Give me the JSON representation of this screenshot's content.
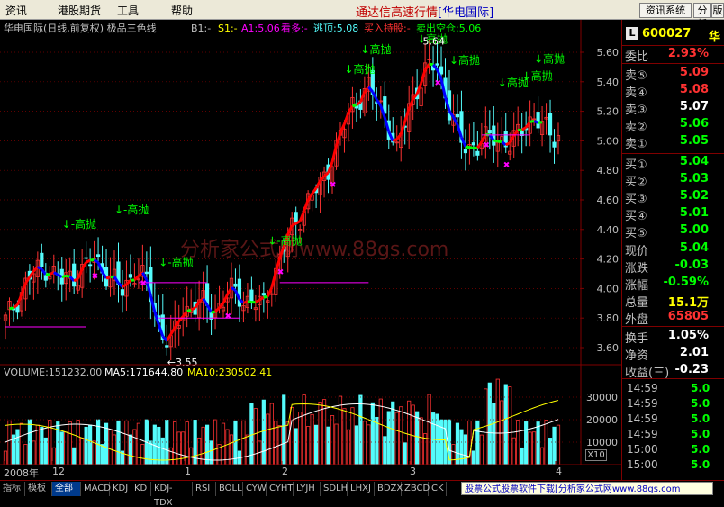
{
  "menu": {
    "items": [
      "资讯",
      "港股期货",
      "工具",
      "帮助"
    ],
    "title": "通达信高速行情",
    "source": "[华电国际]",
    "buttons": [
      "资讯系统",
      "分析",
      "版"
    ]
  },
  "chart_header": {
    "name": "华电国际(日线,前复权) 极品三色线",
    "b1": "B1:-",
    "s1": "S1:-",
    "a1": "A1:5.06",
    "kanduo": "看多:-",
    "taoding": "逃顶:5.08",
    "mairu": "买入持股:-",
    "maichu": "卖出空仓:5.06"
  },
  "watermark": "分析家公式网www.88gs.com",
  "colors": {
    "up": "#ff3232",
    "down": "#54fcfc",
    "signal": "#00ff00",
    "line_up": "#ff0000",
    "line_down": "#0000ff",
    "line_flat": "#00ff00",
    "grid": "#800000",
    "axis_text": "#c0c0c0",
    "ma5": "#ffffff",
    "ma10": "#ffff00",
    "magenta": "#ff00ff"
  },
  "chart_data": [
    {
      "type": "candlestick",
      "ylim": [
        3.5,
        5.7
      ],
      "y_ticks": [
        "5.60",
        "5.40",
        "5.20",
        "5.00",
        "4.80",
        "4.60",
        "4.40",
        "4.20",
        "4.00",
        "3.80",
        "3.60"
      ],
      "x_labels": [
        "2008年",
        "12",
        "1",
        "2",
        "3",
        "4"
      ],
      "annotations": [
        "↓-高抛",
        "↓-高抛",
        "↓-高抛",
        "↓-高抛",
        "↓高抛",
        "↓高抛",
        "↓高抛",
        "↓高抛",
        "↓高抛",
        "↓高抛",
        "↓高抛",
        "←3.55",
        "5.64"
      ],
      "low_price_label": "←3.55",
      "high_price_label": "5.64"
    },
    {
      "type": "bar",
      "title": "VOLUME:151232.00",
      "ma5": "MA5:171644.80",
      "ma10": "MA10:230502.41",
      "y_ticks": [
        "30000",
        "20000",
        "10000"
      ],
      "ylim": [
        0,
        40000
      ]
    }
  ],
  "quote": {
    "code": "600027",
    "name": "华",
    "weibi_label": "委比",
    "weibi": "2.93%",
    "sells": [
      {
        "label": "卖⑤",
        "price": "5.09"
      },
      {
        "label": "卖④",
        "price": "5.08"
      },
      {
        "label": "卖③",
        "price": "5.07"
      },
      {
        "label": "卖②",
        "price": "5.06"
      },
      {
        "label": "卖①",
        "price": "5.05"
      }
    ],
    "buys": [
      {
        "label": "买①",
        "price": "5.04"
      },
      {
        "label": "买②",
        "price": "5.03"
      },
      {
        "label": "买③",
        "price": "5.02"
      },
      {
        "label": "买④",
        "price": "5.01"
      },
      {
        "label": "买⑤",
        "price": "5.00"
      }
    ],
    "stats": [
      {
        "label": "现价",
        "value": "5.04"
      },
      {
        "label": "涨跌",
        "value": "-0.03"
      },
      {
        "label": "涨幅",
        "value": "-0.59%"
      },
      {
        "label": "总量",
        "value": "15.1万"
      },
      {
        "label": "外盘",
        "value": "65805"
      }
    ],
    "fundamentals": [
      {
        "label": "换手",
        "value": "1.05%"
      },
      {
        "label": "净资",
        "value": "2.01"
      },
      {
        "label": "收益(三)",
        "value": "-0.23"
      }
    ],
    "trades": [
      {
        "time": "14:59",
        "price": "5.0"
      },
      {
        "time": "14:59",
        "price": "5.0"
      },
      {
        "time": "14:59",
        "price": "5.0"
      },
      {
        "time": "14:59",
        "price": "5.0"
      },
      {
        "time": "15:00",
        "price": "5.0"
      },
      {
        "time": "15:00",
        "price": "5.0"
      }
    ]
  },
  "tabs": [
    "指标",
    "模板",
    "全部",
    "MACD",
    "KDJ",
    "KD",
    "KDJ-TDX",
    "RSI",
    "BOLL",
    "CYW",
    "CYHT",
    "LYJH",
    "SDLH",
    "LHXJ",
    "BDZX",
    "ZBCD",
    "CK"
  ],
  "ad": "股票公式股票软件下载[分析家公式网www.88gs.com",
  "scroll_x10": "X10",
  "period": "日线"
}
